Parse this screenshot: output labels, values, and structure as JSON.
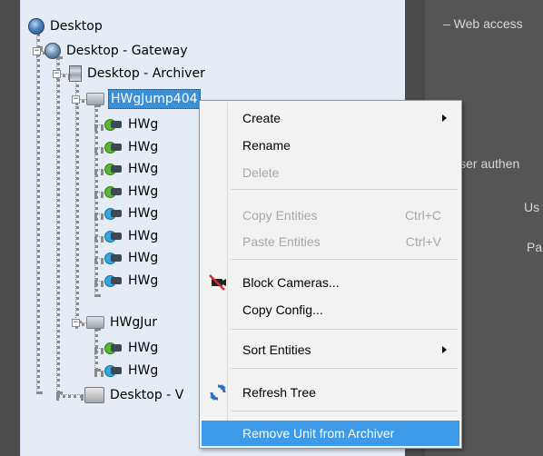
{
  "tree": {
    "root": "Desktop",
    "gateway": "Desktop - Gateway",
    "archiver": "Desktop - Archiver",
    "unit1": "HWgJump404",
    "cameras_unit1": [
      "HWg",
      "HWg",
      "HWg",
      "HWg",
      "HWg",
      "HWg",
      "HWg",
      "HWg"
    ],
    "unit2": "HWgJur",
    "cameras_unit2": [
      "HWg",
      "HWg"
    ],
    "video_node": "Desktop - V"
  },
  "right_panel": {
    "web_access": "– Web access",
    "user_auth": "User authen",
    "user_label": "Us",
    "pass_label": "Pa"
  },
  "context_menu": {
    "create": "Create",
    "rename": "Rename",
    "delete": "Delete",
    "copy_entities": "Copy Entities",
    "copy_shortcut": "Ctrl+C",
    "paste_entities": "Paste Entities",
    "paste_shortcut": "Ctrl+V",
    "block_cameras": "Block Cameras...",
    "copy_config": "Copy Config...",
    "sort_entities": "Sort Entities",
    "refresh_tree": "Refresh Tree",
    "remove_unit": "Remove Unit from Archiver"
  },
  "colors": {
    "selection": "#3b8fd6",
    "menu_highlight": "#3d9ae8",
    "tree_bg": "#e6ecf5",
    "dark_bg": "#4c4c4c"
  }
}
